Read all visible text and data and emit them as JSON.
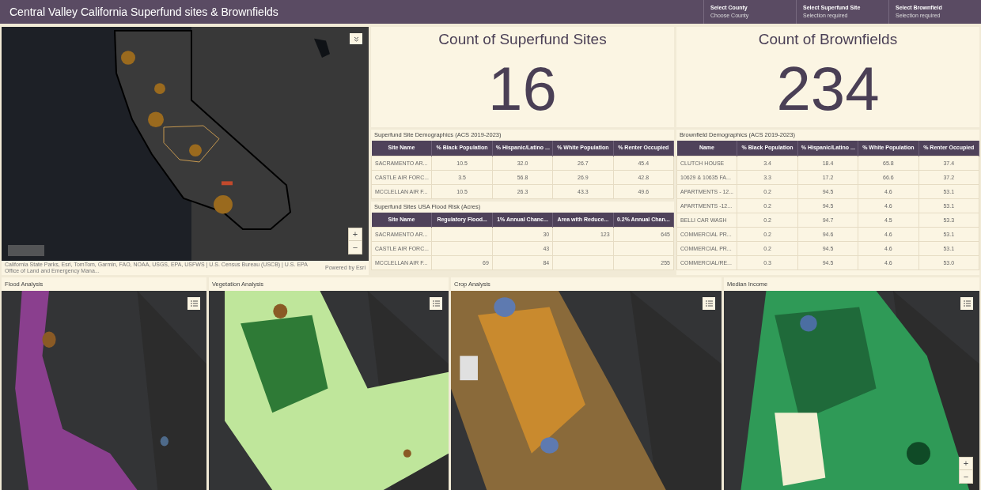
{
  "header": {
    "title": "Central Valley California Superfund sites & Brownfields",
    "selectors": [
      {
        "label": "Select County",
        "value": "Choose County"
      },
      {
        "label": "Select Superfund Site",
        "value": "Selection required"
      },
      {
        "label": "Select Brownfield",
        "value": "Selection required"
      }
    ]
  },
  "main_map": {
    "attribution": "California State Parks, Esri, TomTom, Garmin, FAO, NOAA, USGS, EPA, USFWS | U.S. Census Bureau (USCB) | U.S. EPA Office of Land and Emergency Mana...",
    "powered_by": "Powered by Esri",
    "zoom_in": "+",
    "zoom_out": "−"
  },
  "counts": [
    {
      "title": "Count of Superfund Sites",
      "value": "16"
    },
    {
      "title": "Count of Brownfields",
      "value": "234"
    }
  ],
  "superfund_demographics": {
    "title": "Superfund Site Demographics (ACS 2019-2023)",
    "columns": [
      "Site Name",
      "% Black Population",
      "% Hispanic/Latino ...",
      "% White Population",
      "% Renter Occupied"
    ],
    "rows": [
      [
        "SACRAMENTO AR...",
        "10.5",
        "32.0",
        "26.7",
        "45.4"
      ],
      [
        "CASTLE AIR FORC...",
        "3.5",
        "56.8",
        "26.9",
        "42.8"
      ],
      [
        "MCCLELLAN AIR F...",
        "10.5",
        "26.3",
        "43.3",
        "49.6"
      ]
    ]
  },
  "flood_risk": {
    "title": "Superfund Sites USA Flood Risk (Acres)",
    "columns": [
      "Site Name",
      "Regulatory Flood...",
      "1% Annual Chanc...",
      "Area with Reduce...",
      "0.2% Annual Chan..."
    ],
    "rows": [
      [
        "SACRAMENTO AR...",
        "",
        "30",
        "123",
        "645"
      ],
      [
        "CASTLE AIR FORC...",
        "",
        "43",
        "",
        ""
      ],
      [
        "MCCLELLAN AIR F...",
        "69",
        "84",
        "",
        "255"
      ]
    ]
  },
  "brownfield_demographics": {
    "title": "Brownfield Demographics (ACS 2019-2023)",
    "columns": [
      "Name",
      "% Black Population",
      "% Hispanic/Latino ...",
      "% White Population",
      "% Renter Occupied"
    ],
    "rows": [
      [
        "CLUTCH HOUSE",
        "3.4",
        "18.4",
        "65.8",
        "37.4"
      ],
      [
        "10629 & 10635 FA...",
        "3.3",
        "17.2",
        "66.6",
        "37.2"
      ],
      [
        "APARTMENTS - 12...",
        "0.2",
        "94.5",
        "4.6",
        "53.1"
      ],
      [
        "APARTMENTS -12...",
        "0.2",
        "94.5",
        "4.6",
        "53.1"
      ],
      [
        "BELLI CAR WASH",
        "0.2",
        "94.7",
        "4.5",
        "53.3"
      ],
      [
        "COMMERCIAL PR...",
        "0.2",
        "94.6",
        "4.6",
        "53.1"
      ],
      [
        "COMMERCIAL PR...",
        "0.2",
        "94.5",
        "4.6",
        "53.1"
      ],
      [
        "COMMERCIAL/RE...",
        "0.3",
        "94.5",
        "4.6",
        "53.0"
      ]
    ]
  },
  "analysis_maps": [
    {
      "title": "Flood Analysis",
      "kind": "flood"
    },
    {
      "title": "Vegetation Analysis",
      "kind": "vegetation"
    },
    {
      "title": "Crop Analysis",
      "kind": "crop"
    },
    {
      "title": "Median Income",
      "kind": "income",
      "zoom_in": "+",
      "zoom_out": "−"
    }
  ]
}
